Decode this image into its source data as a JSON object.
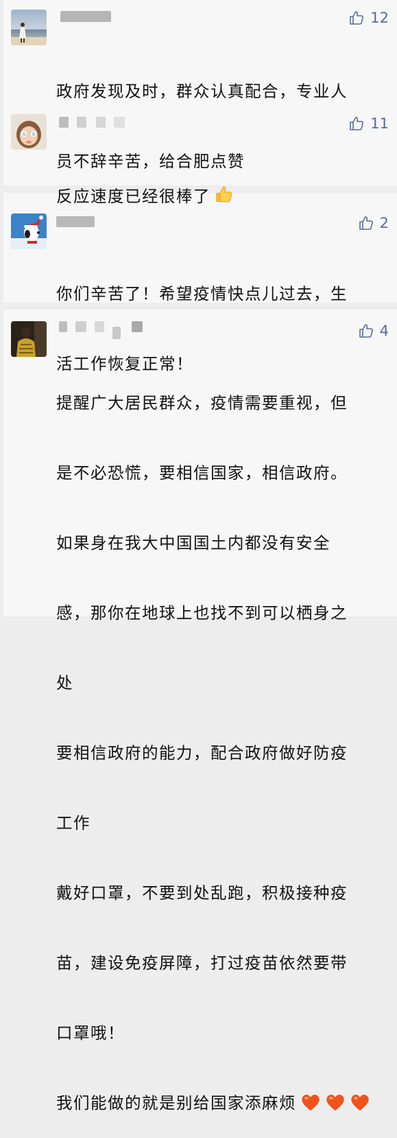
{
  "colors": {
    "background": "#ededed",
    "card": "#f7f7f7",
    "like_blue": "#576b95",
    "text": "#111111",
    "heart": "#f0521c"
  },
  "comments": [
    {
      "avatar_icon": "beach-photo-avatar",
      "likes": "12",
      "lines": [
        "政府发现及时，群众认真配合，专业人",
        "员不辞辛苦，给合肥点赞"
      ],
      "trailing_emoji": null
    },
    {
      "avatar_icon": "child-glasses-avatar",
      "likes": "11",
      "lines": [
        "反应速度已经很棒了"
      ],
      "trailing_emoji": "thumbs-up-emoji"
    },
    {
      "avatar_icon": "snoopy-santa-avatar",
      "likes": "2",
      "lines": [
        "你们辛苦了！希望疫情快点儿过去，生",
        "活工作恢复正常！"
      ],
      "trailing_emoji": null
    },
    {
      "avatar_icon": "dark-figure-avatar",
      "likes": "4",
      "lines": [
        "提醒广大居民群众，疫情需要重视，但",
        "是不必恐慌，要相信国家，相信政府。",
        "如果身在我大中国国土内都没有安全",
        "感，那你在地球上也找不到可以栖身之",
        "处",
        "要相信政府的能力，配合政府做好防疫",
        "工作",
        "戴好口罩，不要到处乱跑，积极接种疫",
        "苗，建设免疫屏障，打过疫苗依然要带",
        "口罩哦！",
        "我们能做的就是别给国家添麻烦"
      ],
      "trailing_emoji": "heart-emoji-x3"
    }
  ]
}
